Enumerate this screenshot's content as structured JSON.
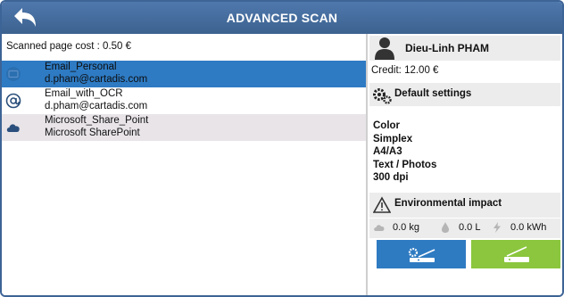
{
  "header": {
    "title": "ADVANCED SCAN"
  },
  "cost": {
    "text": "Scanned page cost : 0.50 €"
  },
  "destinations": [
    {
      "name": "Email_Personal",
      "detail": "d.pham@cartadis.com",
      "icon": "email-icon",
      "selected": true
    },
    {
      "name": "Email_with_OCR",
      "detail": "d.pham@cartadis.com",
      "icon": "at-icon",
      "selected": false
    },
    {
      "name": "Microsoft_Share_Point",
      "detail": "Microsoft SharePoint",
      "icon": "cloud-icon",
      "selected": false
    }
  ],
  "user": {
    "name": "Dieu-Linh PHAM",
    "credit": "Credit: 12.00 €"
  },
  "settings": {
    "title": "Default settings",
    "items": [
      "Color",
      "Simplex",
      "A4/A3",
      "Text / Photos",
      "300 dpi"
    ]
  },
  "environment": {
    "title": "Environmental impact",
    "co2": "0.0 kg",
    "water": "0.0 L",
    "energy": "0.0 kWh"
  },
  "colors": {
    "header": "#3c628f",
    "selected": "#2e7bc4",
    "scan_settings_button": "#2f7bc2",
    "scan_button": "#8bc63e"
  }
}
